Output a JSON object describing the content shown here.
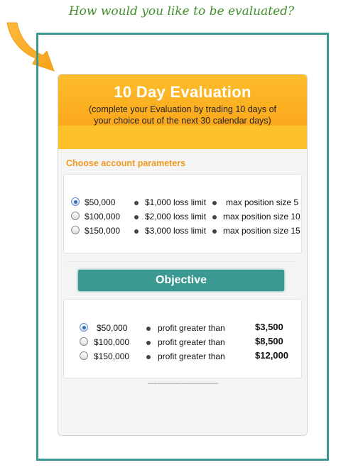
{
  "headline": "How would you like to be evaluated?",
  "colors": {
    "orange": "#fca81d",
    "teal": "#3a9a92",
    "label_orange": "#f29a1e",
    "headline_green": "#3f8f2a"
  },
  "card": {
    "title": "10 Day Evaluation",
    "subtitle_line1": "(complete your Evaluation by trading 10 days of",
    "subtitle_line2": "your choice out of the next 30 calendar days)"
  },
  "account": {
    "label": "Choose account parameters",
    "options": [
      {
        "amount": "$50,000",
        "loss": "$1,000 loss limit",
        "position": "max position size 5",
        "selected": true
      },
      {
        "amount": "$100,000",
        "loss": "$2,000 loss limit",
        "position": "max position size 10",
        "selected": false
      },
      {
        "amount": "$150,000",
        "loss": "$3,000 loss limit",
        "position": "max position size 15",
        "selected": false
      }
    ]
  },
  "objective": {
    "label": "Objective",
    "options": [
      {
        "amount": "$50,000",
        "condition": "profit greater than",
        "target": "$3,500",
        "selected": true
      },
      {
        "amount": "$100,000",
        "condition": "profit greater than",
        "target": "$8,500",
        "selected": false
      },
      {
        "amount": "$150,000",
        "condition": "profit greater than",
        "target": "$12,000",
        "selected": false
      }
    ]
  },
  "divider_text": "-----------------------------------"
}
